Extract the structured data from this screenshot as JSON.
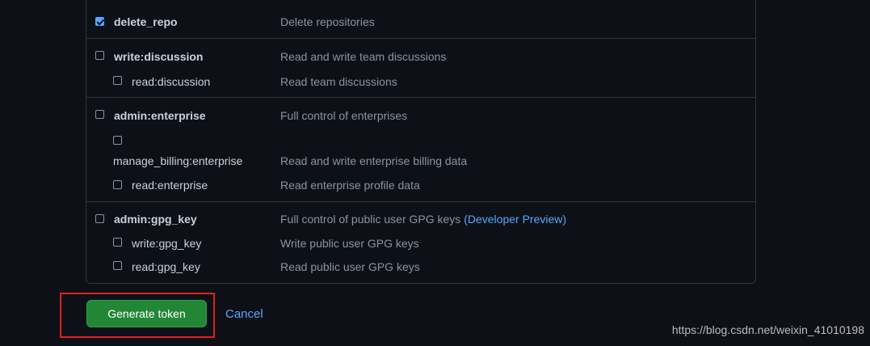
{
  "scopes": {
    "delete_repo": {
      "name": "delete_repo",
      "desc": "Delete repositories",
      "checked": true
    },
    "write_discussion": {
      "name": "write:discussion",
      "desc": "Read and write team discussions"
    },
    "read_discussion": {
      "name": "read:discussion",
      "desc": "Read team discussions"
    },
    "admin_enterprise": {
      "name": "admin:enterprise",
      "desc": "Full control of enterprises"
    },
    "manage_billing_enterprise": {
      "name": "manage_billing:enterprise",
      "desc": "Read and write enterprise billing data"
    },
    "read_enterprise": {
      "name": "read:enterprise",
      "desc": "Read enterprise profile data"
    },
    "admin_gpg_key": {
      "name": "admin:gpg_key",
      "desc": "Full control of public user GPG keys",
      "link": "(Developer Preview)"
    },
    "write_gpg_key": {
      "name": "write:gpg_key",
      "desc": "Write public user GPG keys"
    },
    "read_gpg_key": {
      "name": "read:gpg_key",
      "desc": "Read public user GPG keys"
    }
  },
  "actions": {
    "generate_label": "Generate token",
    "cancel_label": "Cancel"
  },
  "watermark": "https://blog.csdn.net/weixin_41010198",
  "colors": {
    "accent": "#58a6ff",
    "primary_button": "#238636",
    "highlight": "#e0201b"
  }
}
